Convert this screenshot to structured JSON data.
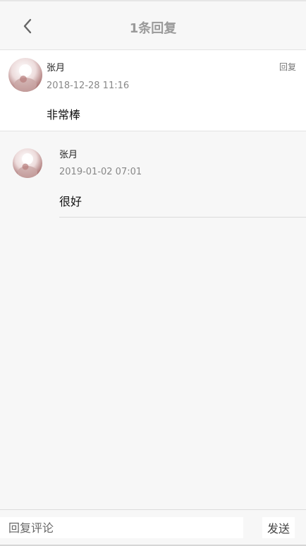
{
  "header": {
    "title": "1条回复",
    "back_icon": "chevron-left-icon"
  },
  "main_comment": {
    "user_name": "张月",
    "time": "2018-12-28 11:16",
    "content": "非常棒",
    "reply_label": "回复"
  },
  "replies": [
    {
      "user_name": "张月",
      "time": "2019-01-02 07:01",
      "content": "很好"
    }
  ],
  "input_bar": {
    "placeholder": "回复评论",
    "value": "",
    "send_label": "发送"
  },
  "colors": {
    "background": "#f7f7f7",
    "card": "#ffffff",
    "title_gray": "#9a9a9a",
    "meta_gray": "#888888"
  }
}
